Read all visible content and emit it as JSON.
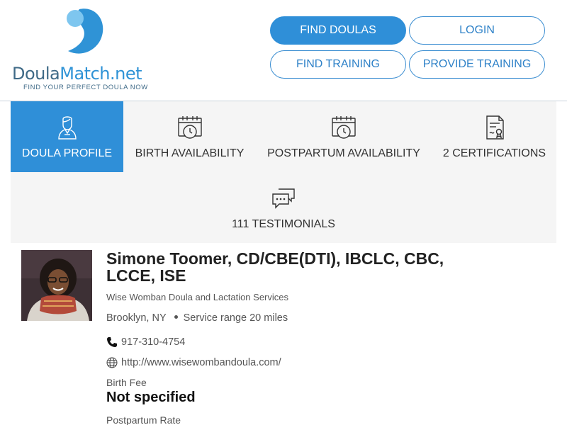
{
  "header": {
    "logo_text_part1": "Doula",
    "logo_text_part2": "Match.net",
    "tagline": "FIND YOUR PERFECT DOULA NOW",
    "logo_colors": {
      "dark": "#3f6a87",
      "light": "#2f93d6",
      "accent": "#7ec6ef"
    },
    "nav": {
      "find_doulas": "FIND DOULAS",
      "login": "LOGIN",
      "find_training": "FIND TRAINING",
      "provide_training": "PROVIDE TRAINING"
    }
  },
  "tabs": [
    {
      "label": "DOULA PROFILE",
      "icon": "doula-person-icon",
      "active": true
    },
    {
      "label": "BIRTH AVAILABILITY",
      "icon": "calendar-clock-icon",
      "active": false
    },
    {
      "label": "POSTPARTUM AVAILABILITY",
      "icon": "calendar-clock-icon",
      "active": false
    },
    {
      "label": "2 CERTIFICATIONS",
      "icon": "certificate-icon",
      "active": false
    },
    {
      "label": "111 TESTIMONIALS",
      "icon": "chat-bubbles-icon",
      "active": false
    }
  ],
  "profile": {
    "name": "Simone Toomer, CD/CBE(DTI), IBCLC, CBC, LCCE, ISE",
    "business": "Wise Womban Doula and Lactation Services",
    "location": "Brooklyn, NY",
    "service_range": "Service range 20 miles",
    "phone": "917-310-4754",
    "website": "http://www.wisewombandoula.com/",
    "birth_fee_label": "Birth Fee",
    "birth_fee_value": "Not specified",
    "postpartum_rate_label": "Postpartum Rate"
  },
  "colors": {
    "primary": "#2f8fd8",
    "tab_bg": "#f5f5f5"
  }
}
